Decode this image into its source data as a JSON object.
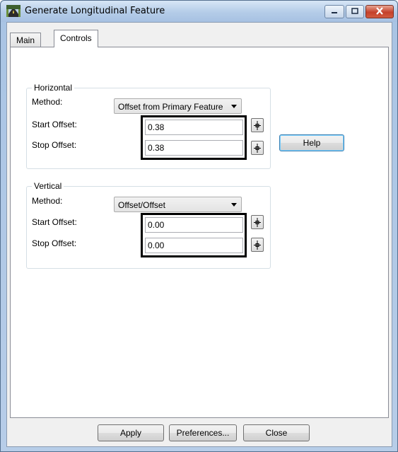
{
  "window": {
    "title": "Generate Longitudinal Feature"
  },
  "tabs": [
    {
      "label": "Main",
      "active": false
    },
    {
      "label": "Controls",
      "active": true
    }
  ],
  "horizontal": {
    "group_label": "Horizontal",
    "method_label": "Method:",
    "method_value": "Offset from Primary Feature",
    "start_label": "Start Offset:",
    "start_value": "0.38",
    "stop_label": "Stop Offset:",
    "stop_value": "0.38"
  },
  "vertical": {
    "group_label": "Vertical",
    "method_label": "Method:",
    "method_value": "Offset/Offset",
    "start_label": "Start Offset:",
    "start_value": "0.00",
    "stop_label": "Stop Offset:",
    "stop_value": "0.00"
  },
  "buttons": {
    "help": "Help",
    "apply": "Apply",
    "preferences": "Preferences...",
    "close": "Close"
  },
  "icons": {
    "app": "road-feature-icon",
    "pick": "crosshair-pick-icon"
  },
  "colors": {
    "title_bar": "#b4cce8",
    "close_button": "#c4402a",
    "highlight_box": "#000000"
  }
}
